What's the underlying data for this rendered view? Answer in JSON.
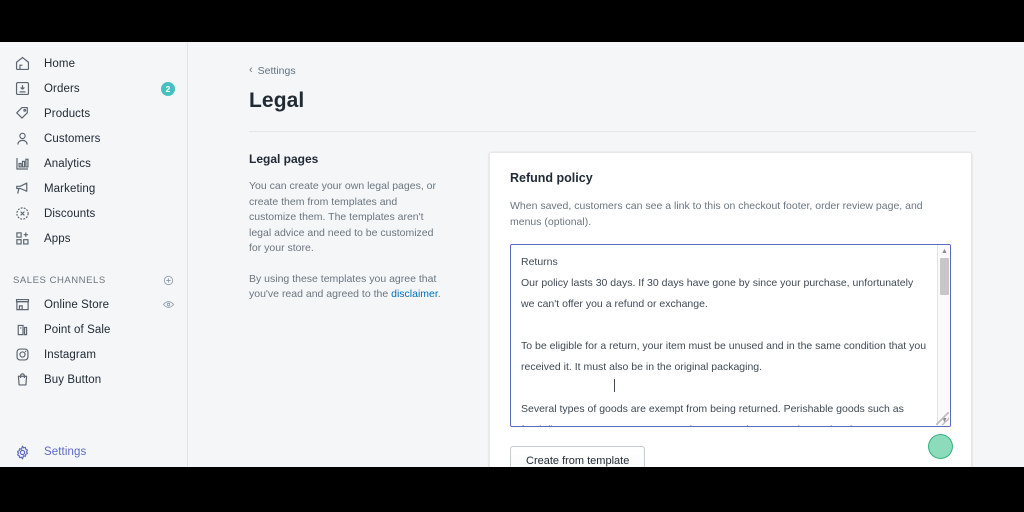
{
  "sidebar": {
    "items": [
      {
        "label": "Home",
        "icon": "home-icon"
      },
      {
        "label": "Orders",
        "icon": "orders-icon",
        "badge": "2"
      },
      {
        "label": "Products",
        "icon": "products-tag-icon"
      },
      {
        "label": "Customers",
        "icon": "customers-person-icon"
      },
      {
        "label": "Analytics",
        "icon": "analytics-bar-chart-icon"
      },
      {
        "label": "Marketing",
        "icon": "marketing-megaphone-icon"
      },
      {
        "label": "Discounts",
        "icon": "discounts-icon"
      },
      {
        "label": "Apps",
        "icon": "apps-grid-plus-icon"
      }
    ],
    "sales_channels": {
      "title": "SALES CHANNELS",
      "add_icon": "plus-circle-icon",
      "items": [
        {
          "label": "Online Store",
          "icon": "online-store-icon",
          "right_icon": "eye-icon"
        },
        {
          "label": "Point of Sale",
          "icon": "point-of-sale-icon"
        },
        {
          "label": "Instagram",
          "icon": "instagram-icon"
        },
        {
          "label": "Buy Button",
          "icon": "buy-button-icon"
        }
      ]
    },
    "settings": {
      "label": "Settings",
      "icon": "gear-icon"
    }
  },
  "main": {
    "breadcrumb": {
      "label": "Settings",
      "icon": "chevron-left-icon"
    },
    "page_title": "Legal",
    "legal_pages": {
      "heading": "Legal pages",
      "paragraph1": "You can create your own legal pages, or create them from templates and customize them. The templates aren't legal advice and need to be customized for your store.",
      "paragraph2_prefix": "By using these templates you agree that you've read and agreed to the ",
      "disclaimer_link": "disclaimer",
      "paragraph2_suffix": "."
    },
    "refund_card": {
      "heading": "Refund policy",
      "helper": "When saved, customers can see a link to this on checkout footer, order review page, and menus (optional).",
      "editor_value": "Returns\nOur policy lasts 30 days. If 30 days have gone by since your purchase, unfortunately we can't offer you a refund or exchange.\n\nTo be eligible for a return, your item must be unused and in the same condition that you received it. It must also be in the original packaging.\n\nSeveral types of goods are exempt from being returned. Perishable goods such as food, flowers, newspapers or magazines cannot be returned. We also do not accept products that are intimate or sanitary goods, hazardous materials, or flammable liquids or gases.",
      "create_button": "Create from template"
    }
  },
  "colors": {
    "accent": "#5c6ac4",
    "badge": "#47c1bf",
    "link": "#006fbb",
    "cursor": "#2dbe82"
  }
}
